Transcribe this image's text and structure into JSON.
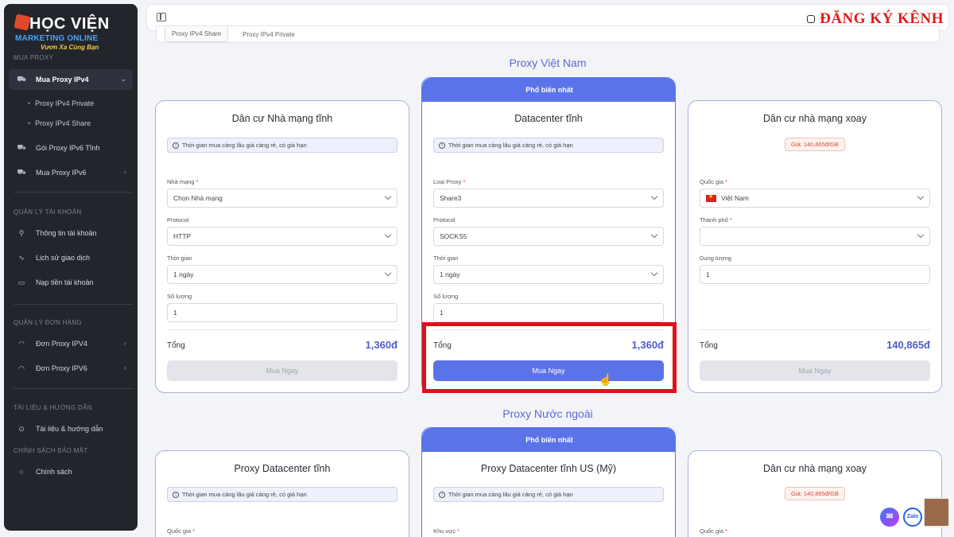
{
  "brand": {
    "title": "HỌC VIỆN",
    "subtitle": "MARKETING ONLINE",
    "tagline": "Vươn Xa Cùng Bạn"
  },
  "watermark": "ĐĂNG KÝ KÊNH",
  "sidebar": {
    "section_buy": "MUA PROXY",
    "buy_ipv4": "Mua Proxy IPv4",
    "sub_private": "Proxy IPv4 Private",
    "sub_share": "Proxy IPv4 Share",
    "ipv6_static": "Gói Proxy IPv6 Tĩnh",
    "buy_ipv6": "Mua Proxy IPv6",
    "section_account": "QUẢN LÝ TÀI KHOẢN",
    "account_info": "Thông tin tài khoản",
    "transactions": "Lịch sử giao dịch",
    "topup": "Nạp tiền tài khoản",
    "section_orders": "QUẢN LÝ ĐƠN HÀNG",
    "orders_ipv4": "Đơn Proxy IPV4",
    "orders_ipv6": "Đơn Proxy IPV6",
    "section_docs": "TÀI LIỆU & HƯỚNG DẪN",
    "docs": "Tài liệu & hướng dẫn",
    "section_policy": "CHÍNH SÁCH BẢO MẬT",
    "policy": "Chính sách"
  },
  "tabs": [
    "Proxy IPv4 Share",
    "Proxy IPv4 Private"
  ],
  "vn_section": "Proxy Việt Nam",
  "foreign_section": "Proxy Nước ngoài",
  "popular_label": "Phổ biến nhất",
  "notice_text": "Thời gian mua càng lâu giá càng rẻ, có giá hạn",
  "cards": {
    "c1": {
      "title": "Dân cư Nhà mạng tĩnh",
      "f1_label": "Nhà mạng",
      "f1_value": "Chọn Nhà mạng",
      "f2_label": "Protocol",
      "f2_value": "HTTP",
      "f3_label": "Thời gian",
      "f3_value": "1 ngày",
      "f4_label": "Số lượng",
      "f4_value": "1",
      "total_label": "Tổng",
      "total": "1,360đ",
      "buy": "Mua Ngay"
    },
    "c2": {
      "title": "Datacenter tĩnh",
      "f1_label": "Loại Proxy",
      "f1_value": "Share3",
      "f2_label": "Protocol",
      "f2_value": "SOCKS5",
      "f3_label": "Thời gian",
      "f3_value": "1 ngày",
      "f4_label": "Số lượng",
      "f4_value": "1",
      "total_label": "Tổng",
      "total": "1,360đ",
      "buy": "Mua Ngay"
    },
    "c3": {
      "title": "Dân cư nhà mạng xoay",
      "price": "Giá: 140,865đ/GB",
      "f1_label": "Quốc gia",
      "f1_value": "Việt Nam",
      "f2_label": "Thành phố",
      "f2_value": "",
      "f3_label": "Dung lượng",
      "f3_value": "1",
      "total_label": "Tổng",
      "total": "140,865đ",
      "buy": "Mua Ngay"
    },
    "c4": {
      "title": "Proxy Datacenter tĩnh",
      "f1_label": "Quốc gia"
    },
    "c5": {
      "title": "Proxy Datacenter tĩnh US (Mỹ)",
      "f1_label": "Khu vực"
    },
    "c6": {
      "title": "Dân cư nhà mạng xoay",
      "price": "Giá: 140,865đ/GB",
      "f1_label": "Quốc gia"
    }
  },
  "fab": {
    "zalo": "Zalo"
  }
}
